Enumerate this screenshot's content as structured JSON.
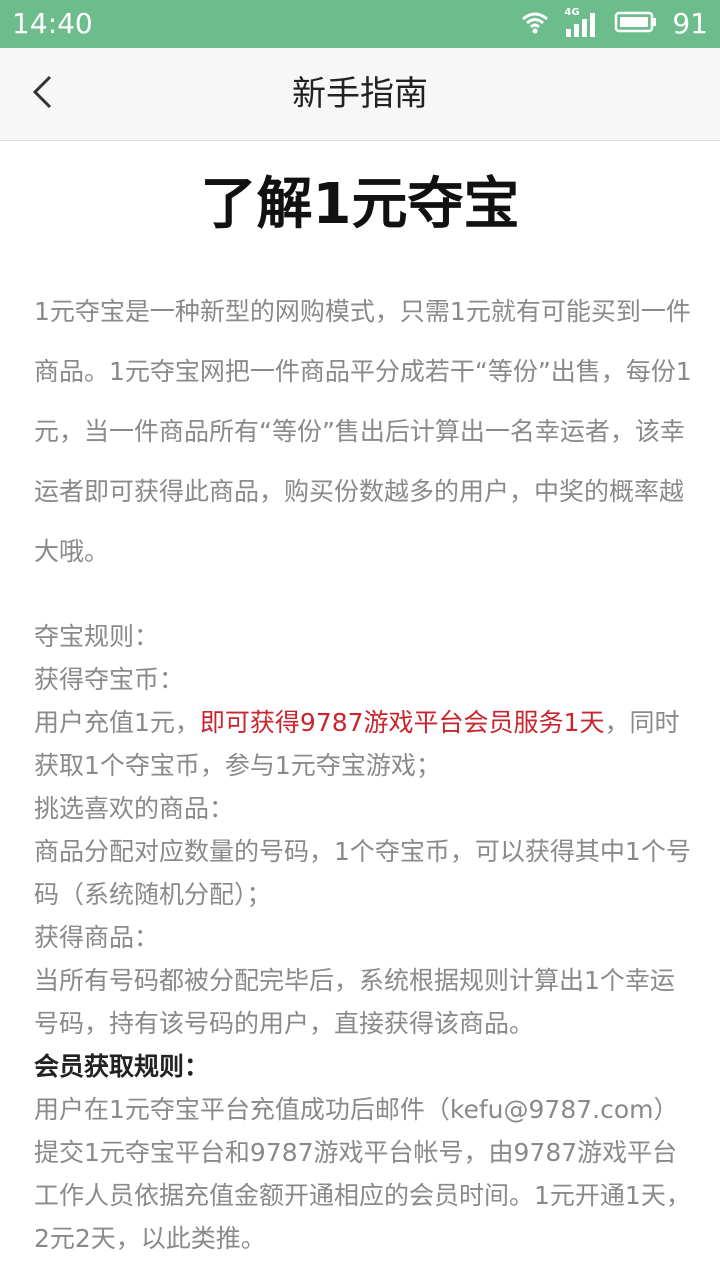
{
  "status_bar": {
    "time": "14:40",
    "network": "4G",
    "battery": "91",
    "icons": [
      "wifi-icon",
      "signal-icon",
      "battery-icon"
    ]
  },
  "nav": {
    "title": "新手指南",
    "back_icon": "chevron-left-icon"
  },
  "article": {
    "title": "了解1元夺宝",
    "intro": "1元夺宝是一种新型的网购模式，只需1元就有可能买到一件商品。1元夺宝网把一件商品平分成若干“等份”出售，每份1元，当一件商品所有“等份”售出后计算出一名幸运者，该幸运者即可获得此商品，购买份数越多的用户，中奖的概率越大哦。",
    "rules_heading": "夺宝规则：",
    "get_coins_heading": "获得夺宝币：",
    "recharge_text_prefix": "用户充值1元，",
    "recharge_highlight": "即可获得9787游戏平台会员服务1天",
    "recharge_text_suffix": "，同时获取1个夺宝币，参与1元夺宝游戏；",
    "choose_heading": "挑选喜欢的商品：",
    "choose_text": "商品分配对应数量的号码，1个夺宝币，可以获得其中1个号码（系统随机分配）；",
    "obtain_heading": "获得商品：",
    "obtain_text": "当所有号码都被分配完毕后，系统根据规则计算出1个幸运号码，持有该号码的用户，直接获得该商品。",
    "member_heading": "会员获取规则：",
    "member_text": "用户在1元夺宝平台充值成功后邮件（kefu@9787.com）提交1元夺宝平台和9787游戏平台帐号，由9787游戏平台工作人员依据充值金额开通相应的会员时间。1元开通1天，2元2天，以此类推。"
  },
  "colors": {
    "status_bar": "#6dbd8c",
    "highlight": "#c9252e",
    "body_text": "#8a8a8a"
  }
}
